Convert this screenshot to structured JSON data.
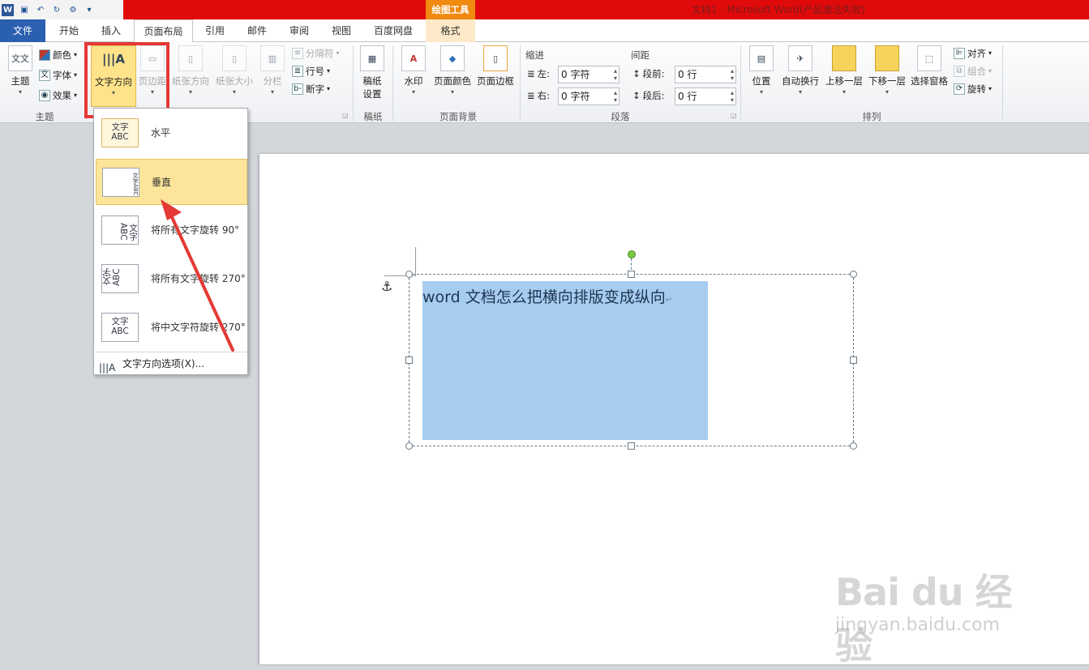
{
  "title_bar": {
    "context_label": "绘图工具",
    "title": "文档1 - Microsoft Word(产品激活失败)"
  },
  "quick_access": {
    "logo": "W",
    "icons": [
      "word-logo-icon",
      "save-icon",
      "undo-icon",
      "redo-icon",
      "repeat-icon",
      "customize-icon"
    ]
  },
  "tabs": [
    "文件",
    "开始",
    "插入",
    "页面布局",
    "引用",
    "邮件",
    "审阅",
    "视图",
    "百度网盘",
    "格式"
  ],
  "active_tab": "页面布局",
  "ribbon": {
    "theme_group": {
      "label": "主题",
      "theme_btn": "主题",
      "theme_icon_text": "文文",
      "colors": "颜色",
      "fonts": "字体",
      "effects": "效果"
    },
    "page_setup": {
      "text_direction": "文字方向",
      "margins": "页边距",
      "orientation": "纸张方向",
      "size": "纸张大小",
      "columns": "分栏",
      "breaks": "分隔符",
      "line_numbers": "行号",
      "hyphenation": "断字"
    },
    "manuscript": {
      "label": "稿纸",
      "btn_line1": "稿纸",
      "btn_line2": "设置"
    },
    "page_background": {
      "label": "页面背景",
      "watermark": "水印",
      "page_color": "页面颜色",
      "page_borders": "页面边框"
    },
    "paragraph": {
      "label": "段落",
      "indent_title": "缩进",
      "left": "左:",
      "left_value": "0 字符",
      "right": "右:",
      "right_value": "0 字符",
      "spacing_title": "间距",
      "before": "段前:",
      "before_value": "0 行",
      "after": "段后:",
      "after_value": "0 行"
    },
    "arrange": {
      "label": "排列",
      "position": "位置",
      "wrap_text": "自动换行",
      "bring_forward": "上移一层",
      "send_backward": "下移一层",
      "selection_pane": "选择窗格",
      "align": "对齐",
      "group": "组合",
      "rotate": "旋转"
    }
  },
  "text_direction_menu": {
    "items": [
      {
        "label": "水平",
        "preview": "文字 ABC"
      },
      {
        "label": "垂直",
        "preview": "文字ABC"
      },
      {
        "label": "将所有文字旋转 90°",
        "preview": "文字 ABC"
      },
      {
        "label": "将所有文字旋转 270°",
        "preview": "文字 ABC"
      },
      {
        "label": "将中文字符旋转 270°",
        "preview": "文字 ABC"
      }
    ],
    "options": "文字方向选项(X)..."
  },
  "document": {
    "textbox_text": "word 文档怎么把横向排版变成纵向",
    "paragraph_mark": "↵"
  },
  "watermark": {
    "logo": "Bai du 经验",
    "url": "jingyan.baidu.com"
  },
  "colors": {
    "title_red": "#e10a0a",
    "context_orange": "#f08a10",
    "file_blue": "#2b5fb0",
    "highlight_red": "#e53935",
    "selection_blue": "#a6cdef"
  }
}
